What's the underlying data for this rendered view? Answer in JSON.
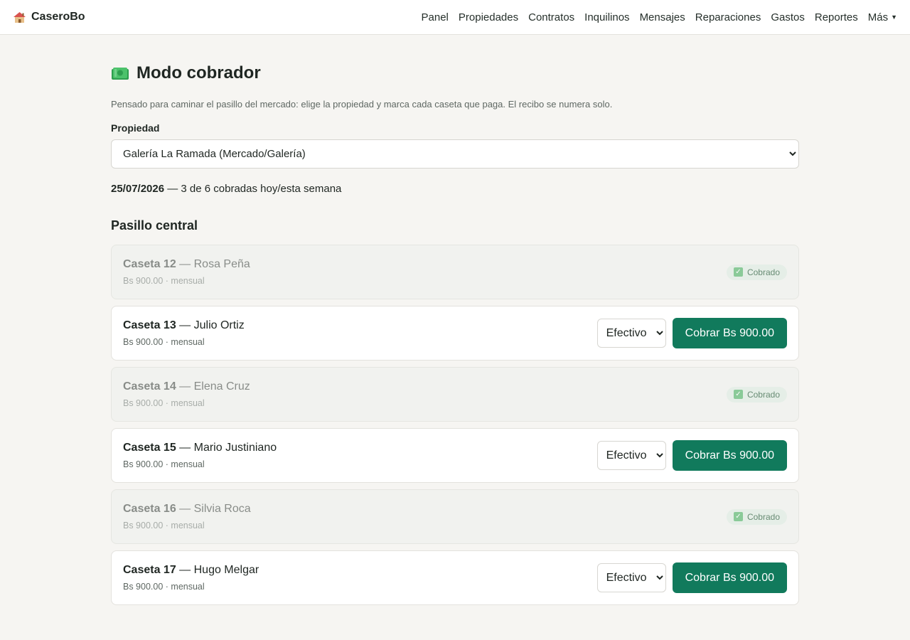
{
  "app": {
    "name": "CaseroBo"
  },
  "nav": [
    {
      "label": "Panel"
    },
    {
      "label": "Propiedades"
    },
    {
      "label": "Contratos"
    },
    {
      "label": "Inquilinos"
    },
    {
      "label": "Mensajes"
    },
    {
      "label": "Reparaciones"
    },
    {
      "label": "Gastos"
    },
    {
      "label": "Reportes"
    },
    {
      "label": "Más"
    }
  ],
  "page": {
    "title": "Modo cobrador",
    "subtitle": "Pensado para caminar el pasillo del mercado: elige la propiedad y marca cada caseta que paga. El recibo se numera solo.",
    "property_label": "Propiedad",
    "property_selected": "Galería La Ramada (Mercado/Galería)",
    "date": "25/07/2026",
    "summary_text": " — 3 de 6 cobradas hoy/esta semana",
    "section_title": "Pasillo central"
  },
  "stalls": [
    {
      "unit": "Caseta 12",
      "tenant": " — Rosa Peña",
      "meta": "Bs 900.00 · mensual",
      "paid": true,
      "status": "Cobrado"
    },
    {
      "unit": "Caseta 13",
      "tenant": " — Julio Ortiz",
      "meta": "Bs 900.00 · mensual",
      "paid": false,
      "method": "Efectivo",
      "button": "Cobrar Bs 900.00"
    },
    {
      "unit": "Caseta 14",
      "tenant": " — Elena Cruz",
      "meta": "Bs 900.00 · mensual",
      "paid": true,
      "status": "Cobrado"
    },
    {
      "unit": "Caseta 15",
      "tenant": " — Mario Justiniano",
      "meta": "Bs 900.00 · mensual",
      "paid": false,
      "method": "Efectivo",
      "button": "Cobrar Bs 900.00"
    },
    {
      "unit": "Caseta 16",
      "tenant": " — Silvia Roca",
      "meta": "Bs 900.00 · mensual",
      "paid": true,
      "status": "Cobrado"
    },
    {
      "unit": "Caseta 17",
      "tenant": " — Hugo Melgar",
      "meta": "Bs 900.00 · mensual",
      "paid": false,
      "method": "Efectivo",
      "button": "Cobrar Bs 900.00"
    }
  ],
  "icons": {
    "brand": "house-icon",
    "title": "money-icon",
    "paid": "check-icon",
    "more": "caret-down-icon"
  },
  "colors": {
    "accent": "#117a5c",
    "paid_badge": "#e4eee6",
    "check": "#79c48a"
  }
}
